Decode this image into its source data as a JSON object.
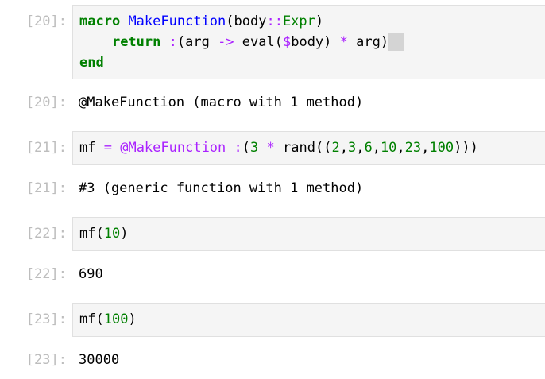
{
  "cells": [
    {
      "in_prompt": "[20]:",
      "line1": {
        "kw_macro": "macro",
        "fname": "MakeFunction",
        "open": "(body",
        "dcolon": "::",
        "type": "Expr",
        "close": ")"
      },
      "line2": {
        "indent": "    ",
        "kw_return": "return",
        "colon": ":",
        "open_arg": "(arg ",
        "arrow": "->",
        "eval_call": " eval(",
        "dollar": "$",
        "body": "body) ",
        "star": "*",
        "arg_close": " arg)"
      },
      "line3": {
        "kw_end": "end"
      },
      "out_prompt": "[20]:",
      "output": "@MakeFunction (macro with 1 method)"
    },
    {
      "in_prompt": "[21]:",
      "code": {
        "var": "mf ",
        "eq": "=",
        "sp": " ",
        "macro": "@MakeFunction",
        "sp2": " ",
        "colon": ":",
        "p1": "(",
        "n3": "3",
        "sp3": " ",
        "star": "*",
        "rand": " rand((",
        "n2": "2",
        "c1": ",",
        "n3b": "3",
        "c2": ",",
        "n6": "6",
        "c3": ",",
        "n10": "10",
        "c4": ",",
        "n23": "23",
        "c5": ",",
        "n100": "100",
        "close": ")))"
      },
      "out_prompt": "[21]:",
      "output": "#3 (generic function with 1 method)"
    },
    {
      "in_prompt": "[22]:",
      "code": {
        "call": "mf(",
        "arg": "10",
        "close": ")"
      },
      "out_prompt": "[22]:",
      "output": "690"
    },
    {
      "in_prompt": "[23]:",
      "code": {
        "call": "mf(",
        "arg": "100",
        "close": ")"
      },
      "out_prompt": "[23]:",
      "output": "30000"
    }
  ],
  "colors": {
    "keyword": "#008000",
    "function_name": "#0000ff",
    "operator": "#aa22ff",
    "number": "#008000",
    "prompt": "#bdbdbd",
    "input_background": "#f5f5f5"
  }
}
